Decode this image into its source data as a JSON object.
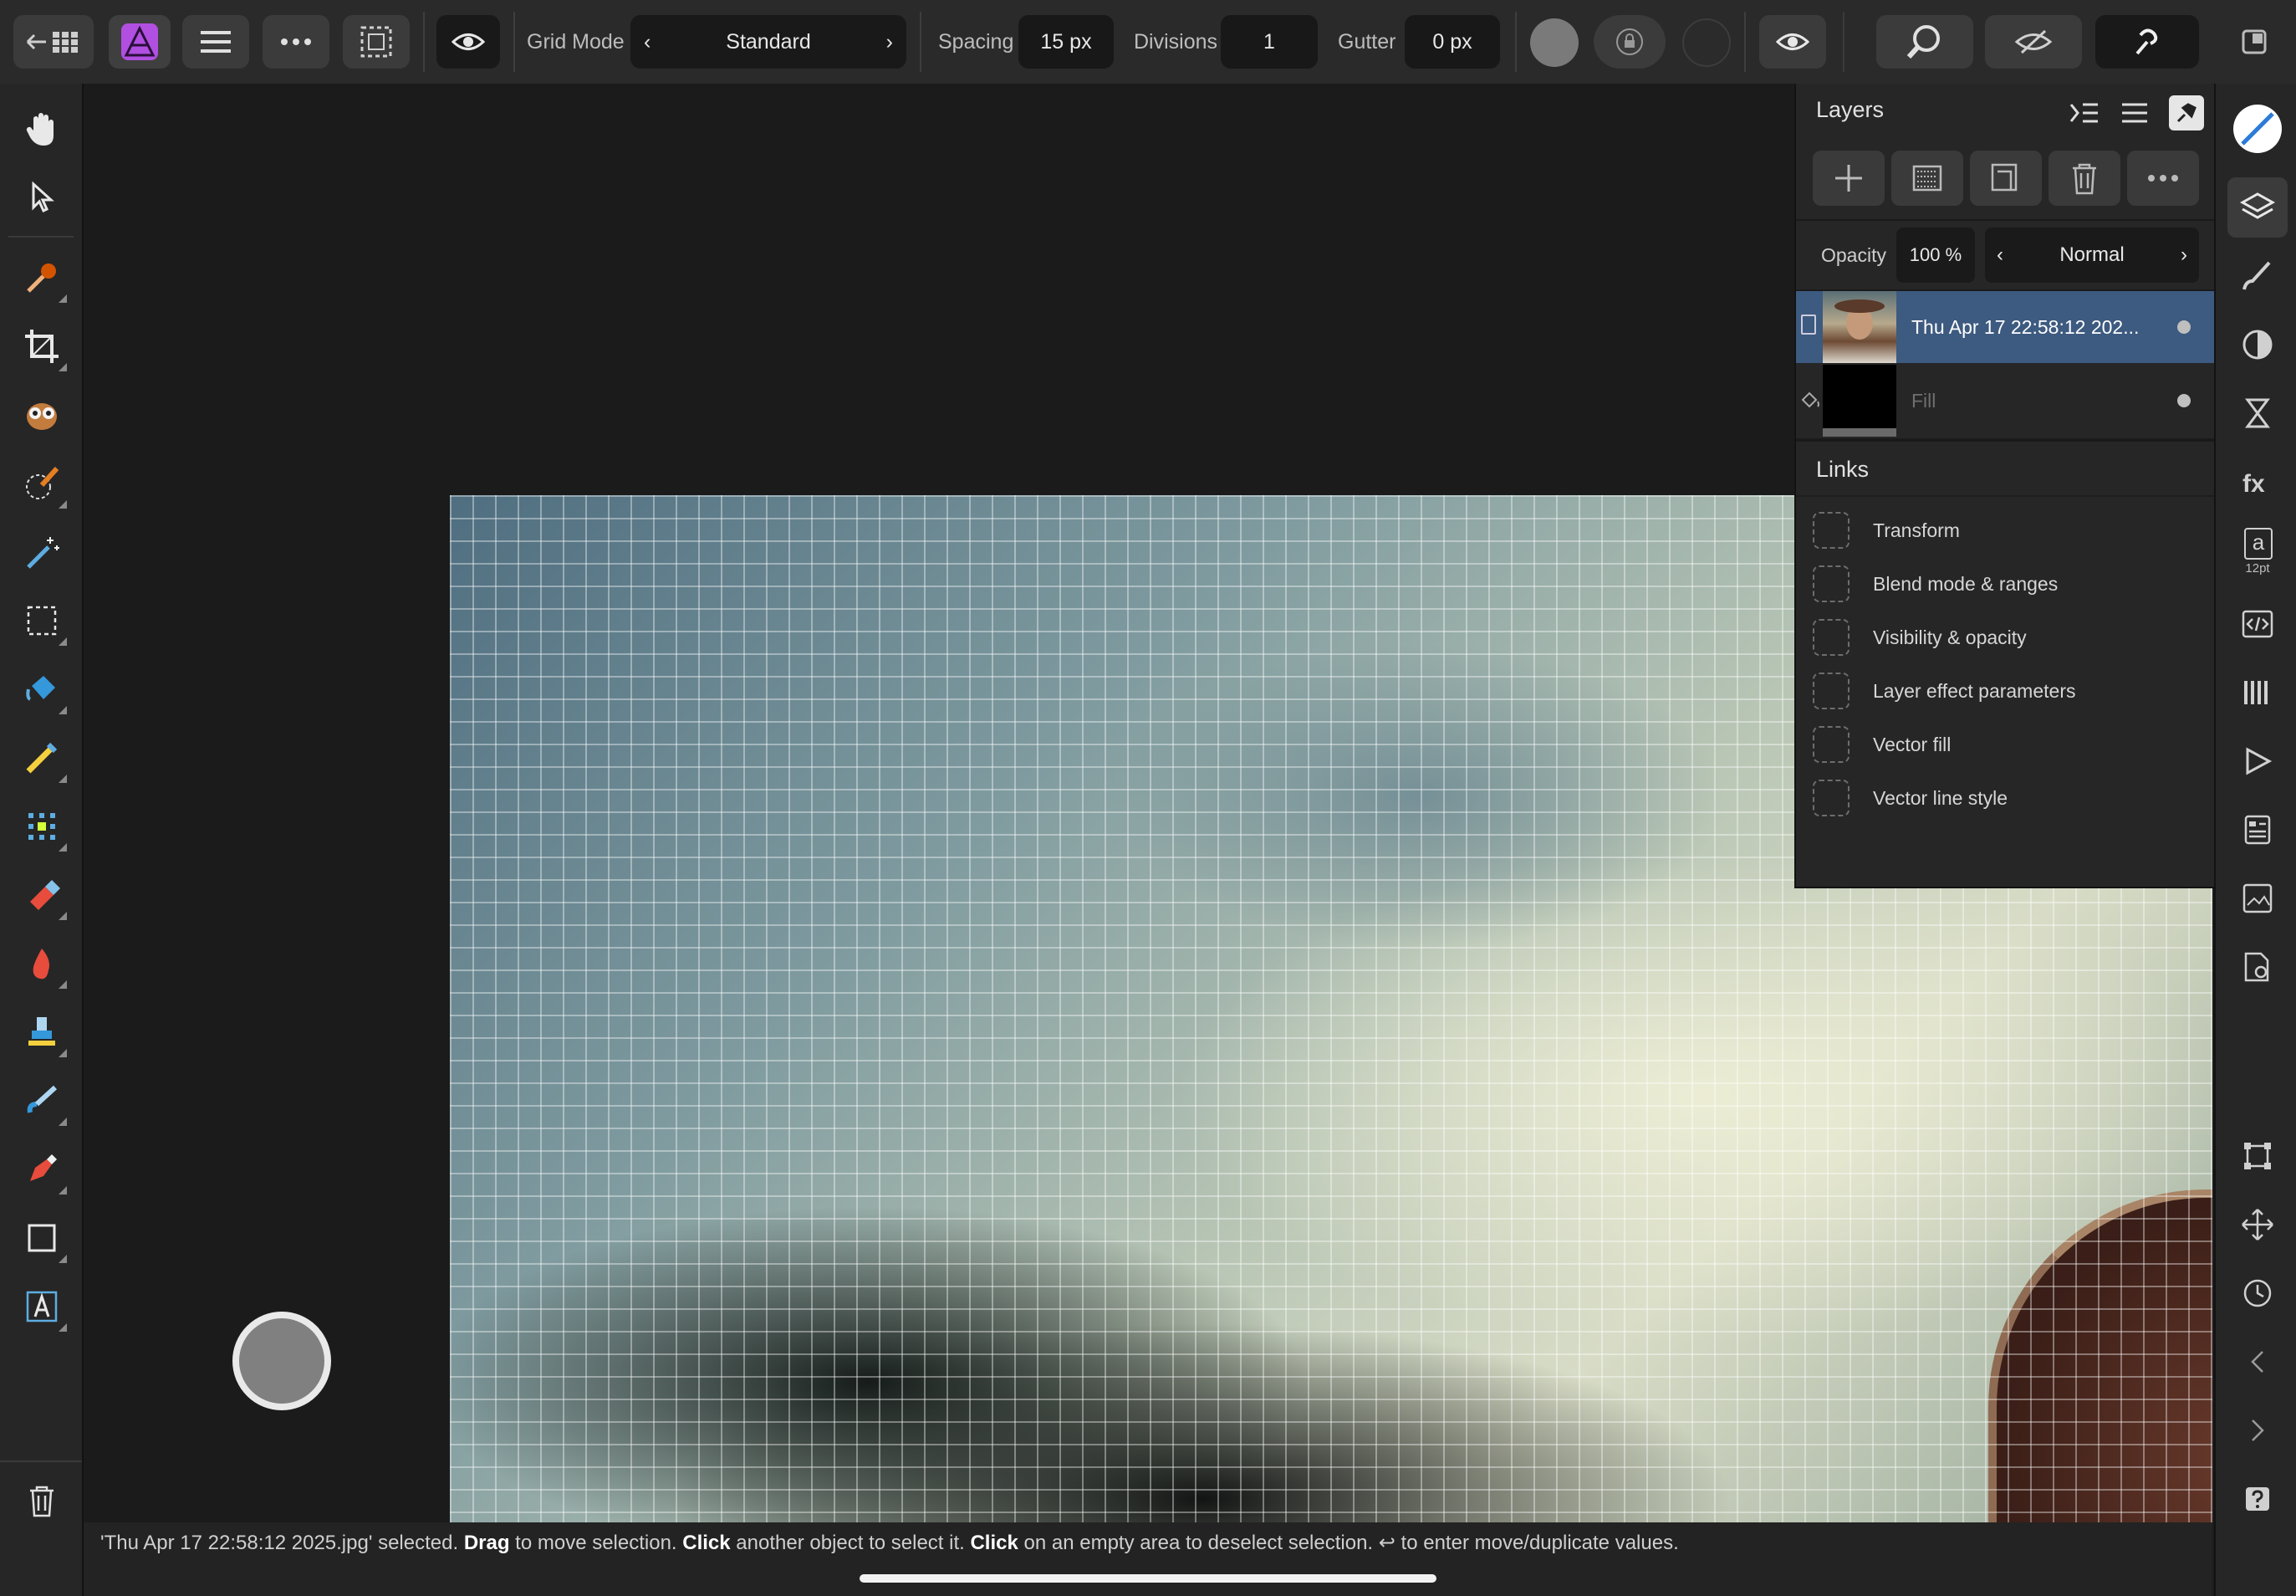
{
  "toolbar": {
    "grid_mode_label": "Grid Mode",
    "grid_mode_value": "Standard",
    "spacing_label": "Spacing",
    "spacing_value": "15 px",
    "divisions_label": "Divisions",
    "divisions_value": "1",
    "gutter_label": "Gutter",
    "gutter_value": "0 px"
  },
  "layers_panel": {
    "title": "Layers",
    "opacity_label": "Opacity",
    "opacity_value": "100 %",
    "blend_mode": "Normal",
    "layers": [
      {
        "name": "Thu Apr 17 22:58:12 202...",
        "selected": true
      },
      {
        "name": "Fill",
        "selected": false
      }
    ]
  },
  "links_panel": {
    "title": "Links",
    "items": [
      "Transform",
      "Blend mode & ranges",
      "Visibility & opacity",
      "Layer effect parameters",
      "Vector fill",
      "Vector line style"
    ]
  },
  "right_bar": {
    "text_style_size": "12pt",
    "text_style_glyph": "a"
  },
  "status": {
    "part1": "'Thu Apr 17 22:58:12 2025.jpg' selected. ",
    "kw_drag": "Drag",
    "part2": " to move selection. ",
    "kw_click1": "Click",
    "part3": " another object to select it. ",
    "kw_click2": "Click",
    "part4": " on an empty area to deselect selection. ↩ to enter move/duplicate values."
  },
  "colors": {
    "accent_blue": "#3d5a80",
    "app_icon_purple": "#b04fe0"
  }
}
